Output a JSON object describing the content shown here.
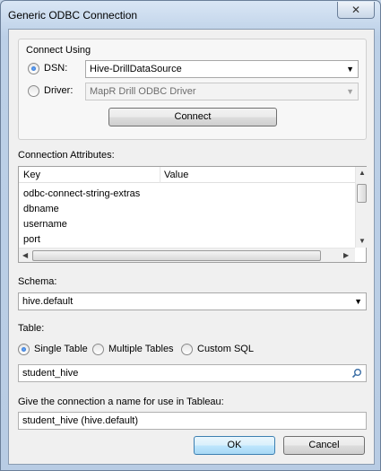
{
  "window": {
    "title": "Generic ODBC Connection",
    "close_glyph": "✕"
  },
  "connect_using": {
    "title": "Connect Using",
    "dsn_label": "DSN:",
    "dsn_value": "Hive-DrillDataSource",
    "driver_label": "Driver:",
    "driver_value": "MapR Drill ODBC Driver",
    "connect_label": "Connect",
    "selected": "DSN"
  },
  "attributes": {
    "title": "Connection Attributes:",
    "headers": {
      "key": "Key",
      "value": "Value"
    },
    "rows": [
      {
        "key": "odbc-connect-string-extras",
        "value": ""
      },
      {
        "key": "dbname",
        "value": ""
      },
      {
        "key": "username",
        "value": ""
      },
      {
        "key": "port",
        "value": ""
      }
    ]
  },
  "schema": {
    "label": "Schema:",
    "value": "hive.default"
  },
  "table": {
    "label": "Table:",
    "options": [
      "Single Table",
      "Multiple Tables",
      "Custom SQL"
    ],
    "selected": "Single Table",
    "search_value": "student_hive"
  },
  "connection_name": {
    "label": "Give the connection a name for use in Tableau:",
    "value": "student_hive (hive.default)"
  },
  "buttons": {
    "ok": "OK",
    "cancel": "Cancel"
  },
  "icons": {
    "close": "close-icon",
    "dropdown": "chevron-down-icon",
    "search": "search-icon",
    "scroll_up": "arrow-up-icon",
    "scroll_down": "arrow-down-icon",
    "scroll_left": "arrow-left-icon",
    "scroll_right": "arrow-right-icon"
  }
}
